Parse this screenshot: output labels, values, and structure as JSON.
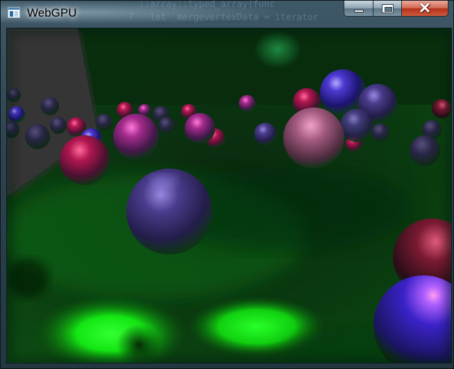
{
  "window": {
    "title": "WebGPU",
    "background_code_line_1": "    ::array::typed_array(func",
    "background_code_line_2": "  7   let _mergevertexData = iterator"
  },
  "controls": {
    "minimize_icon": "minimize-icon",
    "maximize_icon": "maximize-icon",
    "close_icon": "close-icon",
    "close_glyph": "✕"
  },
  "scene": {
    "description_tag": "3d-render-canvas",
    "floor_light_color": "#13ff13",
    "ambient_color": "#0a3a10",
    "sphere_colors": [
      "#3322aa",
      "#aa1155",
      "#aa3399",
      "#5533aa"
    ]
  }
}
